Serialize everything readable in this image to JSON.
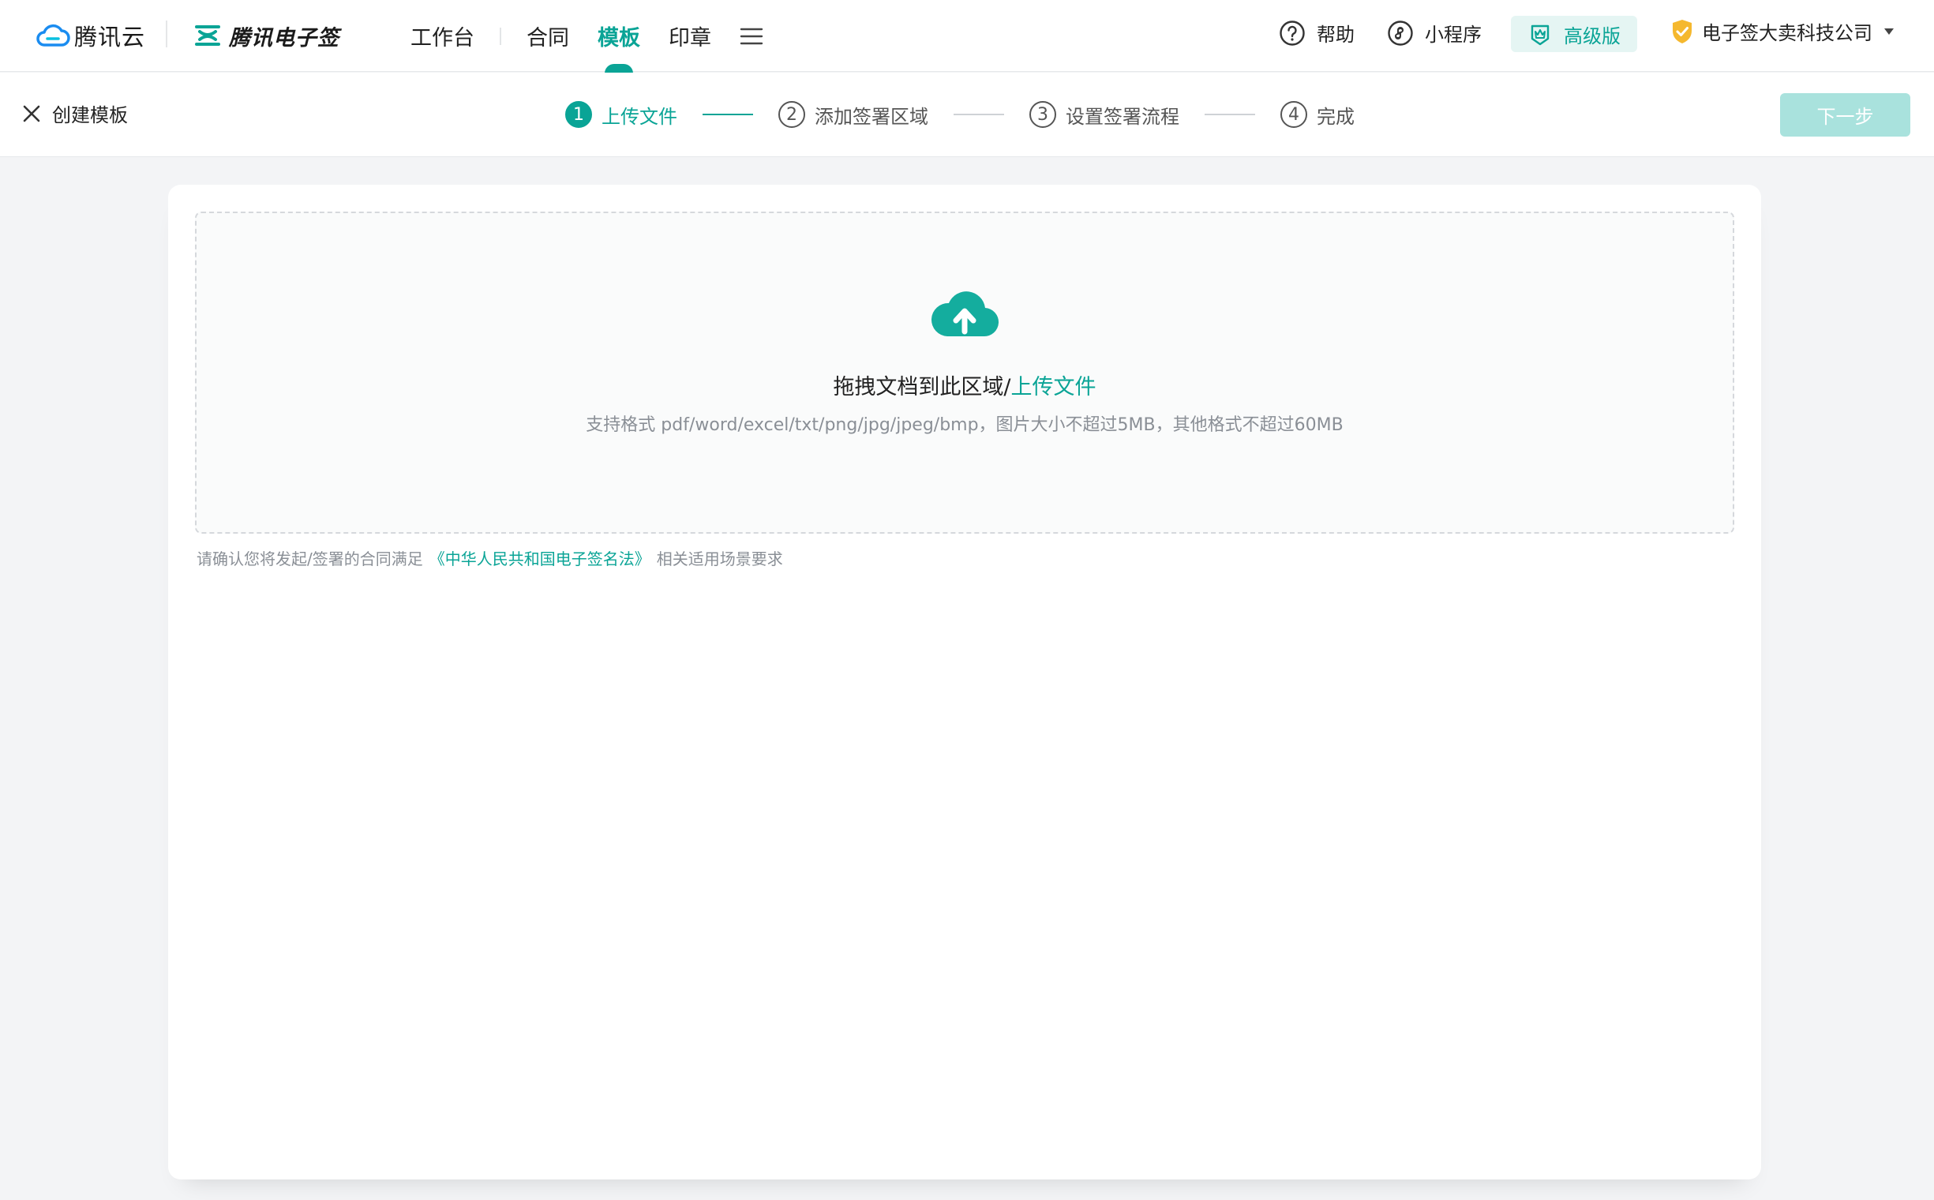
{
  "brand": {
    "cloud_name": "腾讯云",
    "product_name": "腾讯电子签"
  },
  "nav": {
    "items": [
      "工作台",
      "合同",
      "模板",
      "印章"
    ],
    "active_index": 2
  },
  "tools": {
    "help": "帮助",
    "mini_program": "小程序",
    "edition": "高级版",
    "company": "电子签大卖科技公司"
  },
  "page": {
    "title": "创建模板",
    "next_label": "下一步"
  },
  "steps": [
    {
      "num": "1",
      "label": "上传文件"
    },
    {
      "num": "2",
      "label": "添加签署区域"
    },
    {
      "num": "3",
      "label": "设置签署流程"
    },
    {
      "num": "4",
      "label": "完成"
    }
  ],
  "upload": {
    "title_prefix": "拖拽文档到此区域/",
    "title_link": "上传文件",
    "hint": "支持格式 pdf/word/excel/txt/png/jpg/jpeg/bmp，图片大小不超过5MB，其他格式不超过60MB"
  },
  "legal": {
    "prefix": "请确认您将发起/签署的合同满足",
    "link": "《中华人民共和国电子签名法》",
    "suffix": "相关适用场景要求"
  },
  "colors": {
    "accent": "#0aa496",
    "accent_light": "#e5f5f3",
    "button_disabled": "#a9e2dd",
    "shield": "#f5b82e",
    "cloud_blue": "#1a8cf0"
  }
}
